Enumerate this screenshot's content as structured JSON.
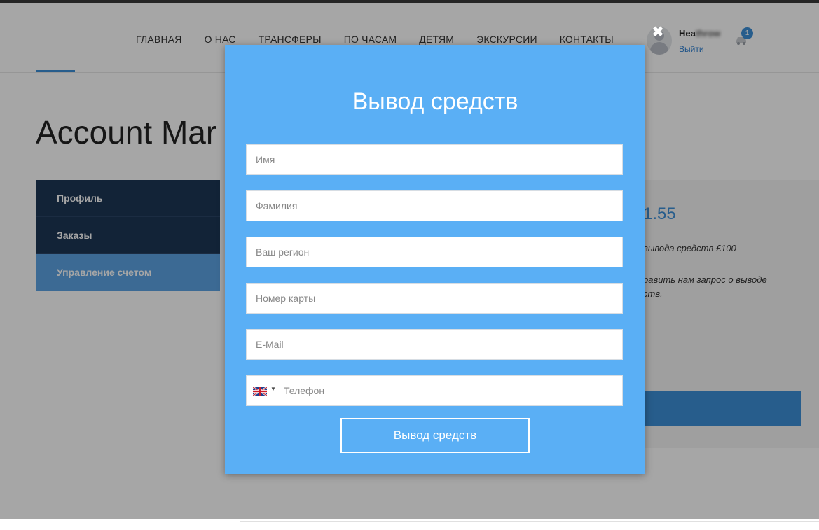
{
  "header": {
    "nav": [
      "ГЛАВНАЯ",
      "О НАС",
      "ТРАНСФЕРЫ",
      "ПО ЧАСАМ",
      "ДЕТЯМ",
      "ЭКСКУРСИИ",
      "КОНТАКТЫ"
    ],
    "user": {
      "name_visible": "Hea",
      "name_blurred": "throw",
      "logout": "Выйти"
    },
    "cart_count": "1"
  },
  "page": {
    "title": "Account Mar",
    "sidebar": [
      "Профиль",
      "Заказы",
      "Управление счетом"
    ],
    "balance": "1.55",
    "note1": "вывода средств £100",
    "note2": "равить нам запрос о выводе ств."
  },
  "modal": {
    "title": "Вывод средств",
    "fields": {
      "first_name": "Имя",
      "last_name": "Фамилия",
      "region": "Ваш регион",
      "card": "Номер карты",
      "email": "E-Mail",
      "phone": "Телефон"
    },
    "submit": "Вывод средств",
    "close_icon": "close-icon"
  },
  "colors": {
    "modal_bg": "#5aaff5",
    "sidebar_bg": "#1d3655",
    "accent": "#3c8fd8"
  }
}
